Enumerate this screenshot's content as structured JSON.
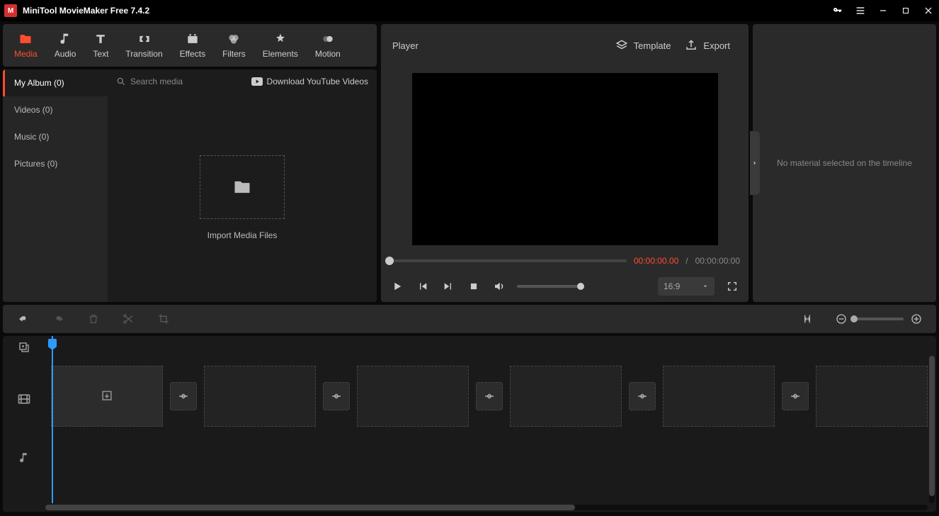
{
  "app": {
    "title": "MiniTool MovieMaker Free 7.4.2"
  },
  "toolTabs": {
    "media": "Media",
    "audio": "Audio",
    "text": "Text",
    "transition": "Transition",
    "effects": "Effects",
    "filters": "Filters",
    "elements": "Elements",
    "motion": "Motion"
  },
  "mediaSidebar": {
    "myAlbum": "My Album (0)",
    "videos": "Videos (0)",
    "music": "Music (0)",
    "pictures": "Pictures (0)"
  },
  "mediaPanel": {
    "searchPlaceholder": "Search media",
    "downloadYT": "Download YouTube Videos",
    "importLabel": "Import Media Files"
  },
  "player": {
    "title": "Player",
    "template": "Template",
    "export": "Export",
    "timeCurrent": "00:00:00.00",
    "timeSeparator": "/",
    "timeTotal": "00:00:00:00",
    "aspect": "16:9"
  },
  "rightPanel": {
    "empty": "No material selected on the timeline"
  }
}
